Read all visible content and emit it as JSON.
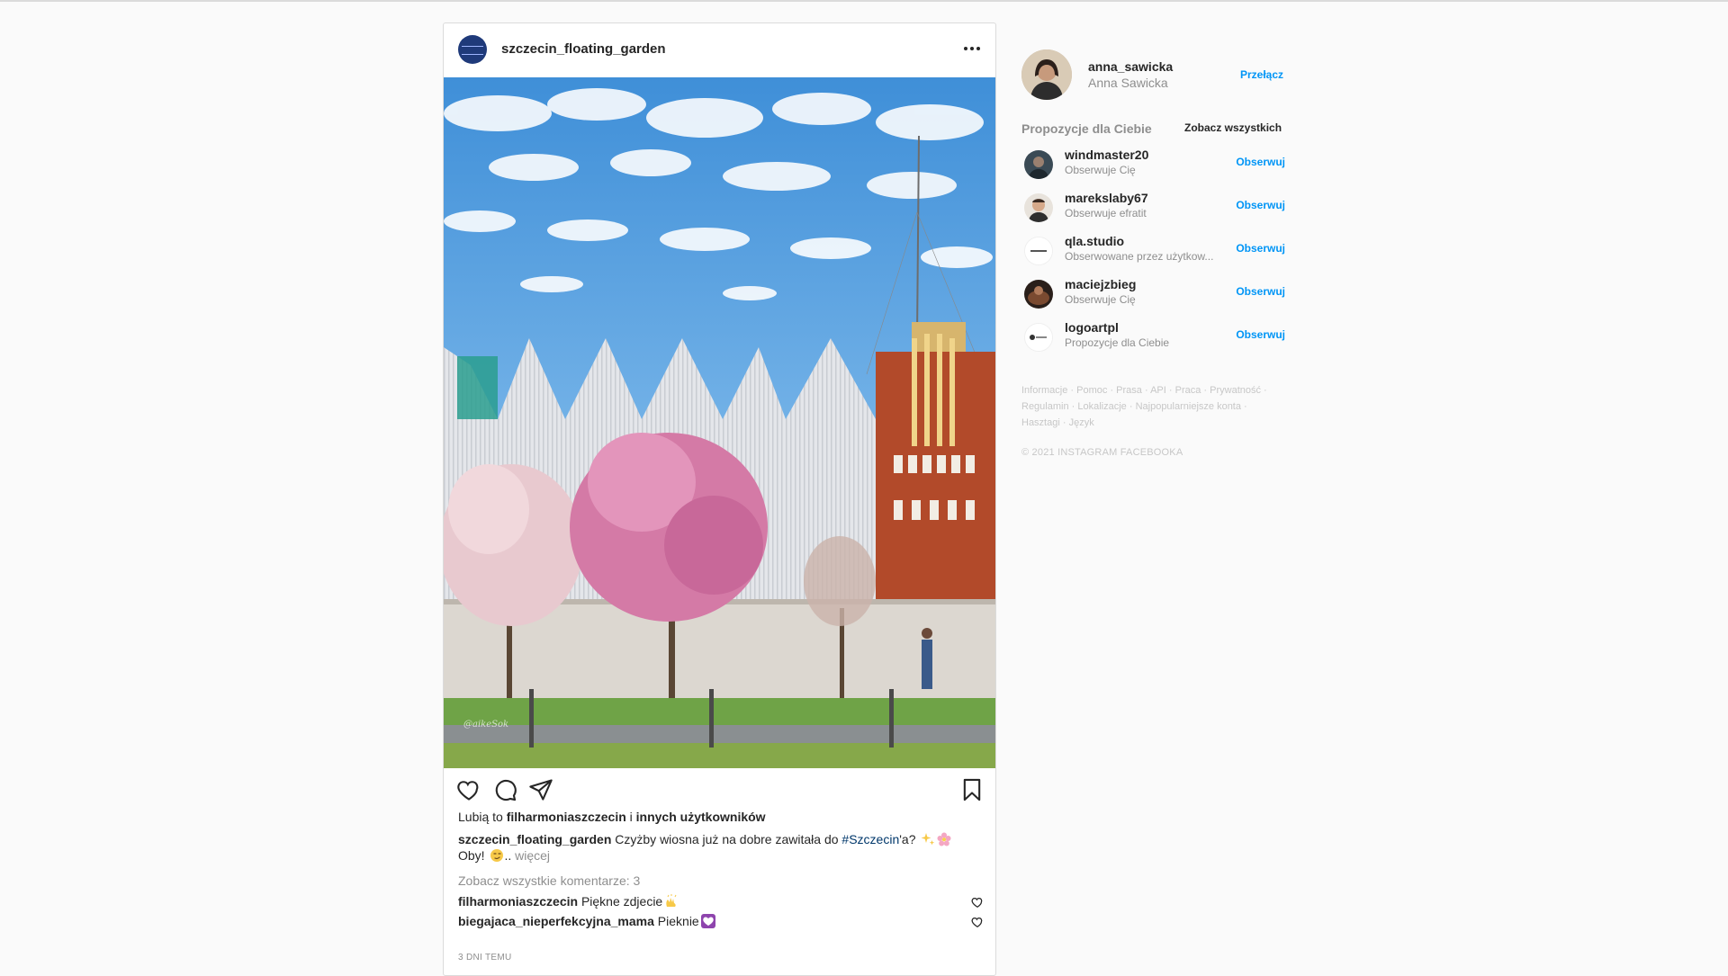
{
  "post": {
    "username": "szczecin_floating_garden",
    "photo_watermark": "@aikeSok",
    "likes": {
      "prefix": "Lubią to ",
      "user": "filharmoniaszczecin",
      "middle": " i ",
      "others": "innych użytkowników"
    },
    "caption": {
      "username": "szczecin_floating_garden",
      "text_before": "Czyżby wiosna już na dobre zawitała do ",
      "hashtag": "#Szczecin",
      "text_after": "'a?",
      "line2": "Oby!",
      "ellipsis": "..",
      "more": "więcej"
    },
    "view_all_comments": "Zobacz wszystkie komentarze: 3",
    "comments": [
      {
        "username": "filharmoniaszczecin",
        "text": "Piękne zdjecie"
      },
      {
        "username": "biegajaca_nieperfekcyjna_mama",
        "text": "Pieknie"
      }
    ],
    "timestamp": "3 DNI TEMU"
  },
  "sidebar": {
    "me": {
      "username": "anna_sawicka",
      "name": "Anna Sawicka",
      "switch_label": "Przełącz"
    },
    "suggestions_title": "Propozycje dla Ciebie",
    "see_all": "Zobacz wszystkich",
    "suggestions": [
      {
        "username": "windmaster20",
        "subtitle": "Obserwuje Cię",
        "follow": "Obserwuj"
      },
      {
        "username": "marekslaby67",
        "subtitle": "Obserwuje efratit",
        "follow": "Obserwuj"
      },
      {
        "username": "qla.studio",
        "subtitle": "Obserwowane przez użytkow...",
        "follow": "Obserwuj"
      },
      {
        "username": "maciejzbieg",
        "subtitle": "Obserwuje Cię",
        "follow": "Obserwuj"
      },
      {
        "username": "logoartpl",
        "subtitle": "Propozycje dla Ciebie",
        "follow": "Obserwuj"
      }
    ],
    "footer_links": [
      "Informacje",
      "Pomoc",
      "Prasa",
      "API",
      "Praca",
      "Prywatność",
      "Regulamin",
      "Lokalizacje",
      "Najpopularniejsze konta",
      "Hasztagi",
      "Język"
    ],
    "copyright": "© 2021 INSTAGRAM FACEBOOKA"
  },
  "colors": {
    "accent": "#0095f6",
    "hashtag": "#00376b",
    "muted": "#8e8e8e",
    "border": "#dbdbdb"
  },
  "icons": [
    "more-icon",
    "heart-icon",
    "comment-icon",
    "share-icon",
    "bookmark-icon"
  ]
}
